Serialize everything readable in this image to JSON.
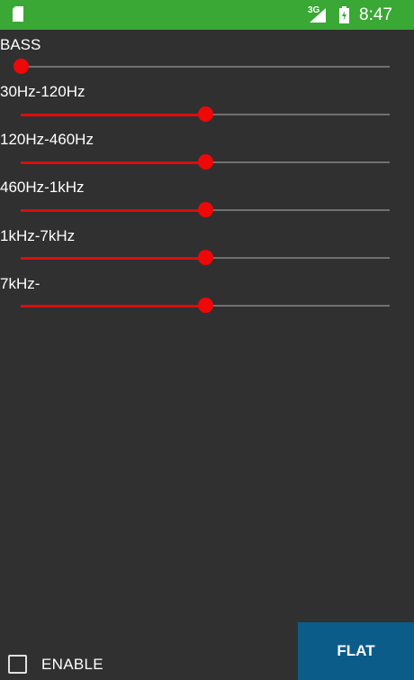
{
  "status_bar": {
    "network": "3G",
    "time": "8:47",
    "icons": [
      "sd-card-icon",
      "signal-icon",
      "battery-charging-icon"
    ]
  },
  "bands": [
    {
      "label": "BASS",
      "level_percent": 0
    },
    {
      "label": "30Hz-120Hz",
      "level_percent": 50
    },
    {
      "label": "120Hz-460Hz",
      "level_percent": 50
    },
    {
      "label": "460Hz-1kHz",
      "level_percent": 50
    },
    {
      "label": "1kHz-7kHz",
      "level_percent": 50
    },
    {
      "label": "7kHz-",
      "level_percent": 50
    }
  ],
  "enable": {
    "label": "ENABLE",
    "checked": false
  },
  "flat_button": {
    "label": "FLAT"
  },
  "colors": {
    "status_bar": "#3aa834",
    "background": "#303030",
    "slider_accent": "#ee0808",
    "slider_track": "#707070",
    "button": "#0c5c8a"
  }
}
